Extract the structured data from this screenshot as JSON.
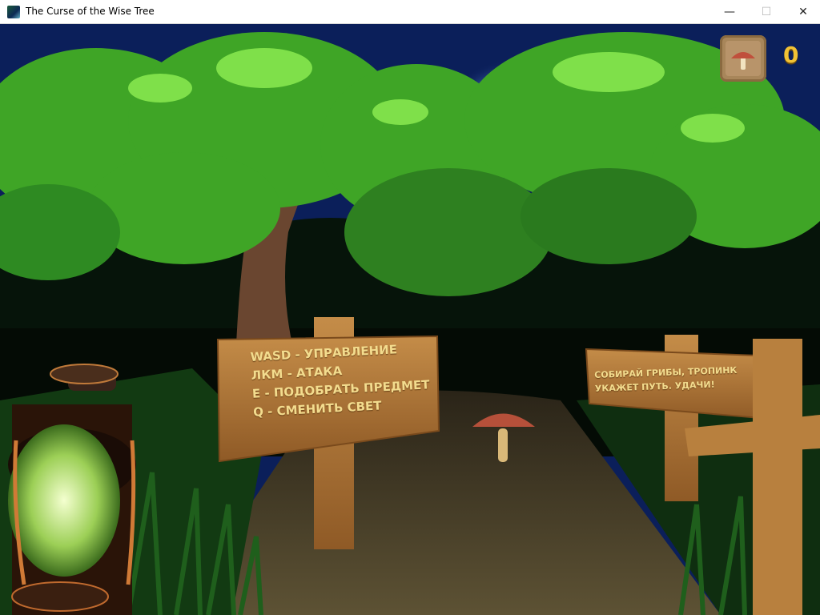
{
  "window": {
    "title": "The Curse of the Wise Tree",
    "minimize_glyph": "—",
    "maximize_glyph": "☐",
    "close_glyph": "✕"
  },
  "hud": {
    "item_icon": "mushroom-icon",
    "mushroom_count": "0"
  },
  "sign_controls": {
    "lines": [
      "WASD - УПРАВЛЕНИЕ",
      "ЛКМ - АТАКА",
      "E - ПОДОБРАТЬ ПРЕДМЕТ",
      "Q - СМЕНИТЬ СВЕТ"
    ]
  },
  "sign_hint": {
    "lines": [
      "СОБИРАЙ ГРИБЫ, ТРОПИНК",
      "УКАЖЕТ ПУТЬ. УДАЧИ!"
    ]
  },
  "colors": {
    "sky": "#0b1f5a",
    "foliage": "#3fa526",
    "wood": "#b07a3e",
    "sign_text": "#f3dc8e",
    "hud_count": "#f2c234",
    "mushroom_cap": "#b6503a"
  }
}
